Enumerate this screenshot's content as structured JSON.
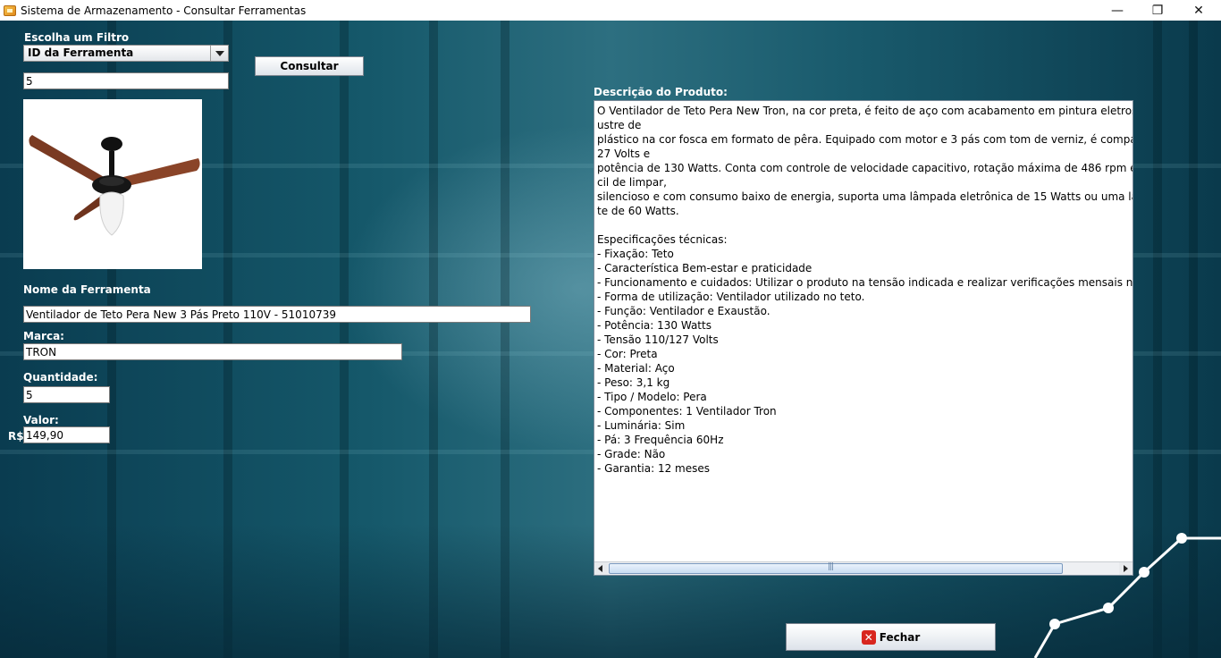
{
  "window": {
    "title": "Sistema de Armazenamento - Consultar Ferramentas",
    "minimize_glyph": "—",
    "maximize_glyph": "❐",
    "close_glyph": "✕"
  },
  "filter": {
    "label": "Escolha um Filtro",
    "selected": "ID da Ferramenta",
    "search_value": "5",
    "consult_button": "Consultar"
  },
  "product": {
    "image_icon": "ceiling-fan-image",
    "name_label": "Nome da Ferramenta",
    "name_value": "Ventilador de Teto Pera New 3 Pás Preto 110V - 51010739",
    "brand_label": "Marca:",
    "brand_value": "TRON",
    "quantity_label": "Quantidade:",
    "quantity_value": "5",
    "price_label": "Valor:",
    "currency": "R$",
    "price_value": "149,90"
  },
  "description": {
    "label": "Descrição do Produto:",
    "text": "O Ventilador de Teto Pera New Tron, na cor preta, é feito de aço com acabamento em pintura eletrostática a p\nustre de\nplástico na cor fosca em formato de pêra. Equipado com motor e 3 pás com tom de verniz, é compatível com t\n27 Volts e\npotência de 130 Watts. Conta com controle de velocidade capacitivo, rotação máxima de 486 rpm e diâmetro d\ncil de limpar,\nsilencioso e com consumo baixo de energia, suporta uma lâmpada eletrônica de 15 Watts ou uma lâmpada i\nte de 60 Watts.\n\nEspecificações técnicas:\n- Fixação: Teto\n- Característica Bem-estar e praticidade\n- Funcionamento e cuidados: Utilizar o produto na tensão indicada e realizar verificações mensais nas peças\n- Forma de utilização: Ventilador utilizado no teto.\n- Função: Ventilador e Exaustão.\n- Potência: 130 Watts\n- Tensão 110/127 Volts\n- Cor: Preta\n- Material: Aço\n- Peso: 3,1 kg\n- Tipo / Modelo: Pera\n- Componentes: 1 Ventilador Tron\n- Luminária: Sim\n- Pá: 3 Frequência 60Hz\n- Grade: Não\n- Garantia: 12 meses"
  },
  "footer": {
    "close_button": "Fechar"
  },
  "colors": {
    "background": "#0b3d4e",
    "label_text": "#ffffff",
    "close_icon": "#d8261e"
  }
}
